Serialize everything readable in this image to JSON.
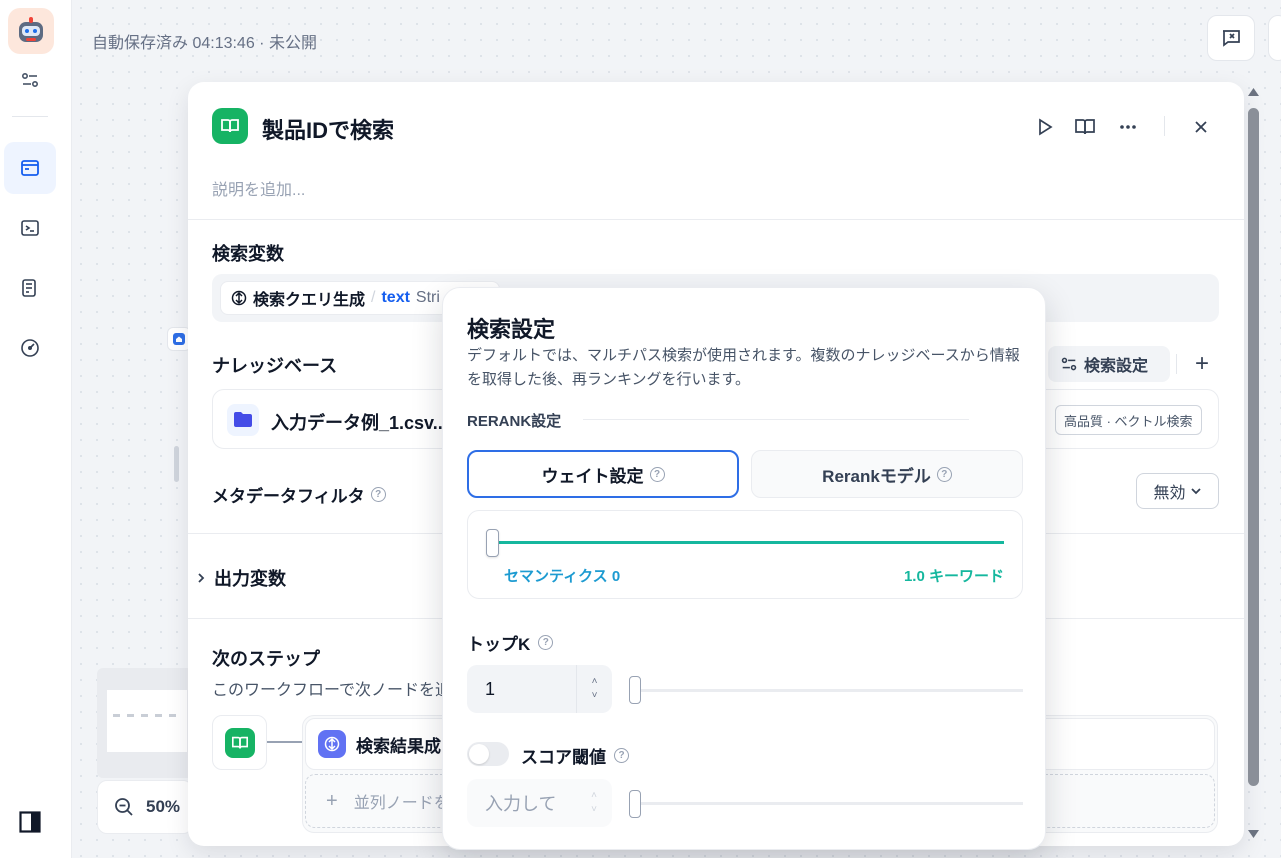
{
  "header": {
    "autosave": "自動保存済み 04:13:46 · 未公開"
  },
  "sidebar": {
    "items": [
      {
        "name": "logo",
        "icon": "robot-icon"
      },
      {
        "name": "settings",
        "icon": "sliders-icon"
      },
      {
        "name": "orchestrate",
        "icon": "window-icon",
        "active": true
      },
      {
        "name": "api",
        "icon": "terminal-icon"
      },
      {
        "name": "logs",
        "icon": "document-icon"
      },
      {
        "name": "monitoring",
        "icon": "gauge-icon"
      }
    ]
  },
  "zoom": {
    "value": "50%"
  },
  "node": {
    "title": "製品IDで検索",
    "description_placeholder": "説明を追加...",
    "query_variable": {
      "label": "検索変数",
      "source": "検索クエリ生成",
      "separator": "/",
      "var_name": "text",
      "var_type": "Stri"
    },
    "knowledge": {
      "label": "ナレッジベース",
      "settings_button": "検索設定",
      "add_button": "+",
      "item_name": "入力データ例_1.csv...",
      "item_badge": "高品質 · ベクトル検索"
    },
    "metadata_filter": {
      "label": "メタデータフィルタ",
      "value": "無効"
    },
    "output_vars": {
      "label": "出力変数"
    },
    "next_step": {
      "label": "次のステップ",
      "description": "このワークフローで次ノードを追加",
      "target_node": "検索結果成",
      "parallel": "並列ノードを"
    }
  },
  "retrieval_popover": {
    "title": "検索設定",
    "description": "デフォルトでは、マルチパス検索が使用されます。複数のナレッジベースから情報を取得した後、再ランキングを行います。",
    "rerank_label": "RERANK設定",
    "tabs": [
      {
        "label": "ウェイト設定",
        "active": true
      },
      {
        "label": "Rerankモデル",
        "active": false
      }
    ],
    "weight": {
      "semantic_label": "セマンティクス 0",
      "keyword_label": "1.0 キーワード",
      "semantic_value": 0,
      "keyword_value": 1.0
    },
    "top_k": {
      "label": "トップK",
      "value": "1"
    },
    "score_threshold": {
      "label": "スコア閾値",
      "placeholder": "入力して",
      "enabled": false
    },
    "colors": {
      "accent": "#2e6ee6",
      "teal": "#15b79e",
      "semantic": "#1d9bd1"
    }
  }
}
